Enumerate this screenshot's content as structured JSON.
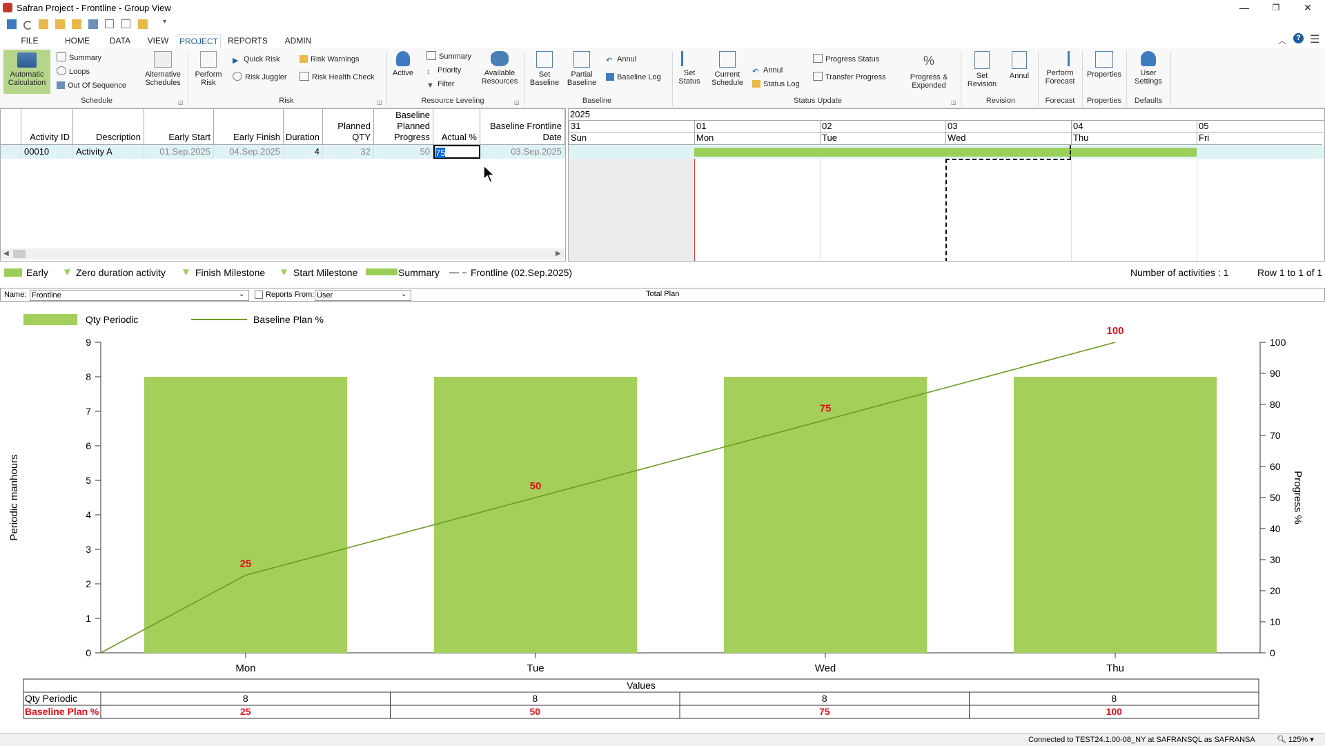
{
  "window": {
    "title": "Safran Project - Frontline - Group View",
    "minimize": "—",
    "restore": "❐",
    "close": "✕"
  },
  "tabs": [
    "FILE",
    "HOME",
    "DATA",
    "VIEW",
    "PROJECT",
    "REPORTS",
    "ADMIN"
  ],
  "active_tab": "PROJECT",
  "ribbon": {
    "schedule": {
      "auto_calc": "Automatic Calculation",
      "summary": "Summary",
      "loops": "Loops",
      "out_of_sequence": "Out Of Sequence",
      "alt_schedules": "Alternative Schedules",
      "label": "Schedule"
    },
    "risk": {
      "perform_risk": "Perform Risk",
      "quick_risk": "Quick Risk",
      "risk_juggler": "Risk Juggler",
      "risk_warnings": "Risk Warnings",
      "risk_health_check": "Risk Health Check",
      "label": "Risk"
    },
    "resource_leveling": {
      "active": "Active",
      "summary": "Summary",
      "priority": "Priority",
      "filter": "Filter",
      "available_resources": "Available Resources",
      "label": "Resource Leveling"
    },
    "baseline": {
      "set_baseline": "Set Baseline",
      "partial_baseline": "Partial Baseline",
      "annul": "Annul",
      "baseline_log": "Baseline Log",
      "label": "Baseline"
    },
    "status_update": {
      "set_status": "Set Status",
      "current_schedule": "Current Schedule",
      "annul": "Annul",
      "status_log": "Status Log",
      "progress_status": "Progress Status",
      "transfer_progress": "Transfer Progress",
      "progress_expended": "Progress & Expended",
      "label": "Status Update"
    },
    "revision": {
      "set_revision": "Set Revision",
      "annul": "Annul",
      "label": "Revision"
    },
    "forecast": {
      "perform_forecast": "Perform Forecast",
      "label": "Forecast"
    },
    "properties": {
      "properties": "Properties",
      "label": "Properties"
    },
    "defaults": {
      "user_settings": "User Settings",
      "label": "Defaults"
    }
  },
  "grid": {
    "headers": {
      "activity_id": "Activity ID",
      "description": "Description",
      "early_start": "Early Start",
      "early_finish": "Early Finish",
      "duration": "Duration",
      "planned_qty_1": "Planned",
      "planned_qty_2": "QTY",
      "bpp_1": "Baseline",
      "bpp_2": "Planned",
      "bpp_3": "Progress",
      "actual": "Actual %",
      "bfd_1": "Baseline Frontline",
      "bfd_2": "Date"
    },
    "row": {
      "activity_id": "00010",
      "description": "Activity A",
      "early_start": "01.Sep.2025",
      "early_finish": "04.Sep.2025",
      "duration": "4",
      "planned_qty": "32",
      "baseline_planned_progress": "50",
      "actual": "75",
      "baseline_frontline_date": "03.Sep.2025"
    }
  },
  "gantt": {
    "year": "2025",
    "days": [
      {
        "num": "31",
        "name": "Sun"
      },
      {
        "num": "01",
        "name": "Mon"
      },
      {
        "num": "02",
        "name": "Tue"
      },
      {
        "num": "03",
        "name": "Wed"
      },
      {
        "num": "04",
        "name": "Thu"
      },
      {
        "num": "05",
        "name": "Fri"
      }
    ]
  },
  "legend": {
    "early": "Early",
    "zero_duration": "Zero duration activity",
    "finish_milestone": "Finish Milestone",
    "start_milestone": "Start Milestone",
    "summary": "Summary",
    "frontline": "Frontline (02.Sep.2025)",
    "num_activities": "Number of activities : 1",
    "rows": "Row 1 to 1 of 1"
  },
  "namebar": {
    "name_label": "Name:",
    "name_value": "Frontline",
    "reports_from_label": "Reports From:",
    "reports_from_value": "User",
    "total_plan": "Total Plan"
  },
  "chart_data": {
    "type": "bar",
    "categories": [
      "Mon",
      "Tue",
      "Wed",
      "Thu"
    ],
    "series": [
      {
        "name": "Qty Periodic",
        "type": "bar",
        "axis": "left",
        "values": [
          8,
          8,
          8,
          8
        ],
        "color": "#a4cf5b"
      },
      {
        "name": "Baseline Plan %",
        "type": "line",
        "axis": "right",
        "x": [
          "start",
          "Mon",
          "Tue",
          "Wed",
          "Thu"
        ],
        "values": [
          0,
          25,
          50,
          75,
          100
        ],
        "color": "#6b9a22"
      }
    ],
    "ylabel": "Periodic manhours",
    "y2label": "Progress %",
    "ylim": [
      0,
      9
    ],
    "y2lim": [
      0,
      100
    ],
    "yticks": [
      "0",
      "1",
      "2",
      "3",
      "4",
      "5",
      "6",
      "7",
      "8",
      "9"
    ],
    "y2ticks": [
      "0",
      "10",
      "20",
      "30",
      "40",
      "50",
      "60",
      "70",
      "80",
      "90",
      "100"
    ],
    "data_labels": [
      "25",
      "50",
      "75",
      "100"
    ],
    "table": {
      "header": "Values",
      "rows": [
        {
          "label": "Qty Periodic",
          "values": [
            "8",
            "8",
            "8",
            "8"
          ]
        },
        {
          "label": "Baseline Plan %",
          "values": [
            "25",
            "50",
            "75",
            "100"
          ]
        }
      ]
    }
  },
  "status": {
    "connection": "Connected to TEST24.1.00-08_NY at SAFRANSQL as SAFRANSA",
    "zoom": "125%"
  }
}
